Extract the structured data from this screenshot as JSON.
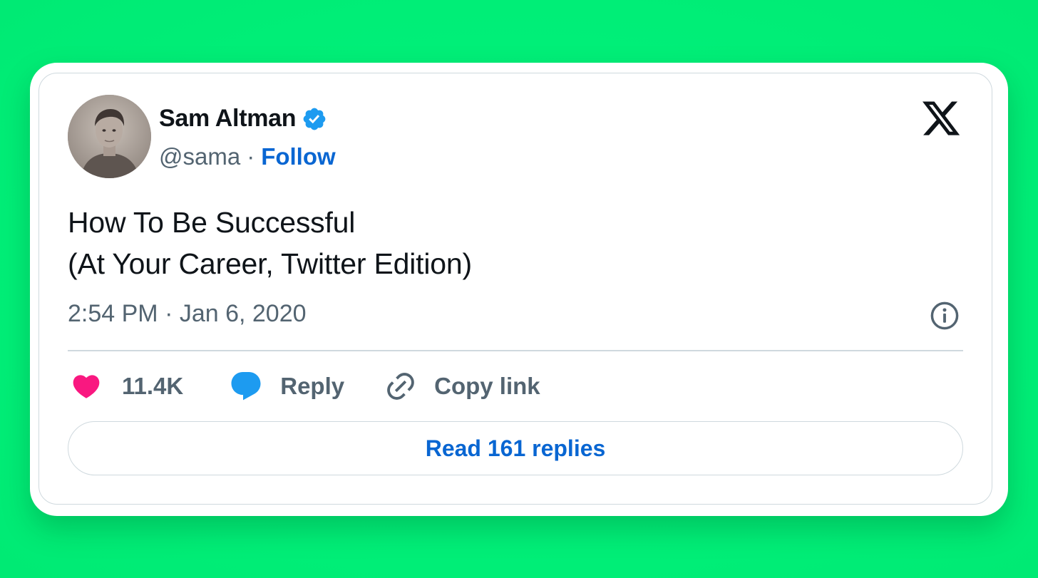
{
  "author": {
    "name": "Sam Altman",
    "handle": "@sama",
    "separator": "·",
    "follow_label": "Follow",
    "verified": true
  },
  "tweet": {
    "lines": [
      "How To Be Successful",
      "(At Your Career, Twitter Edition)"
    ],
    "timestamp": "2:54 PM · Jan 6, 2020"
  },
  "actions": {
    "likes": "11.4K",
    "reply_label": "Reply",
    "copy_link_label": "Copy link"
  },
  "read_replies_label": "Read 161 replies",
  "icons": {
    "brand": "x-logo-icon",
    "verified": "verified-badge-icon",
    "info": "info-icon",
    "like": "heart-icon",
    "reply": "speech-bubble-icon",
    "copy": "link-icon"
  },
  "colors": {
    "background": "#00f07a",
    "card": "#ffffff",
    "border": "#cfd9de",
    "text_primary": "#0f1419",
    "text_secondary": "#536471",
    "link_blue": "#0966d2",
    "verified_blue": "#1d9bf0",
    "heart": "#f91880",
    "reply_bubble": "#1d9bf0"
  }
}
